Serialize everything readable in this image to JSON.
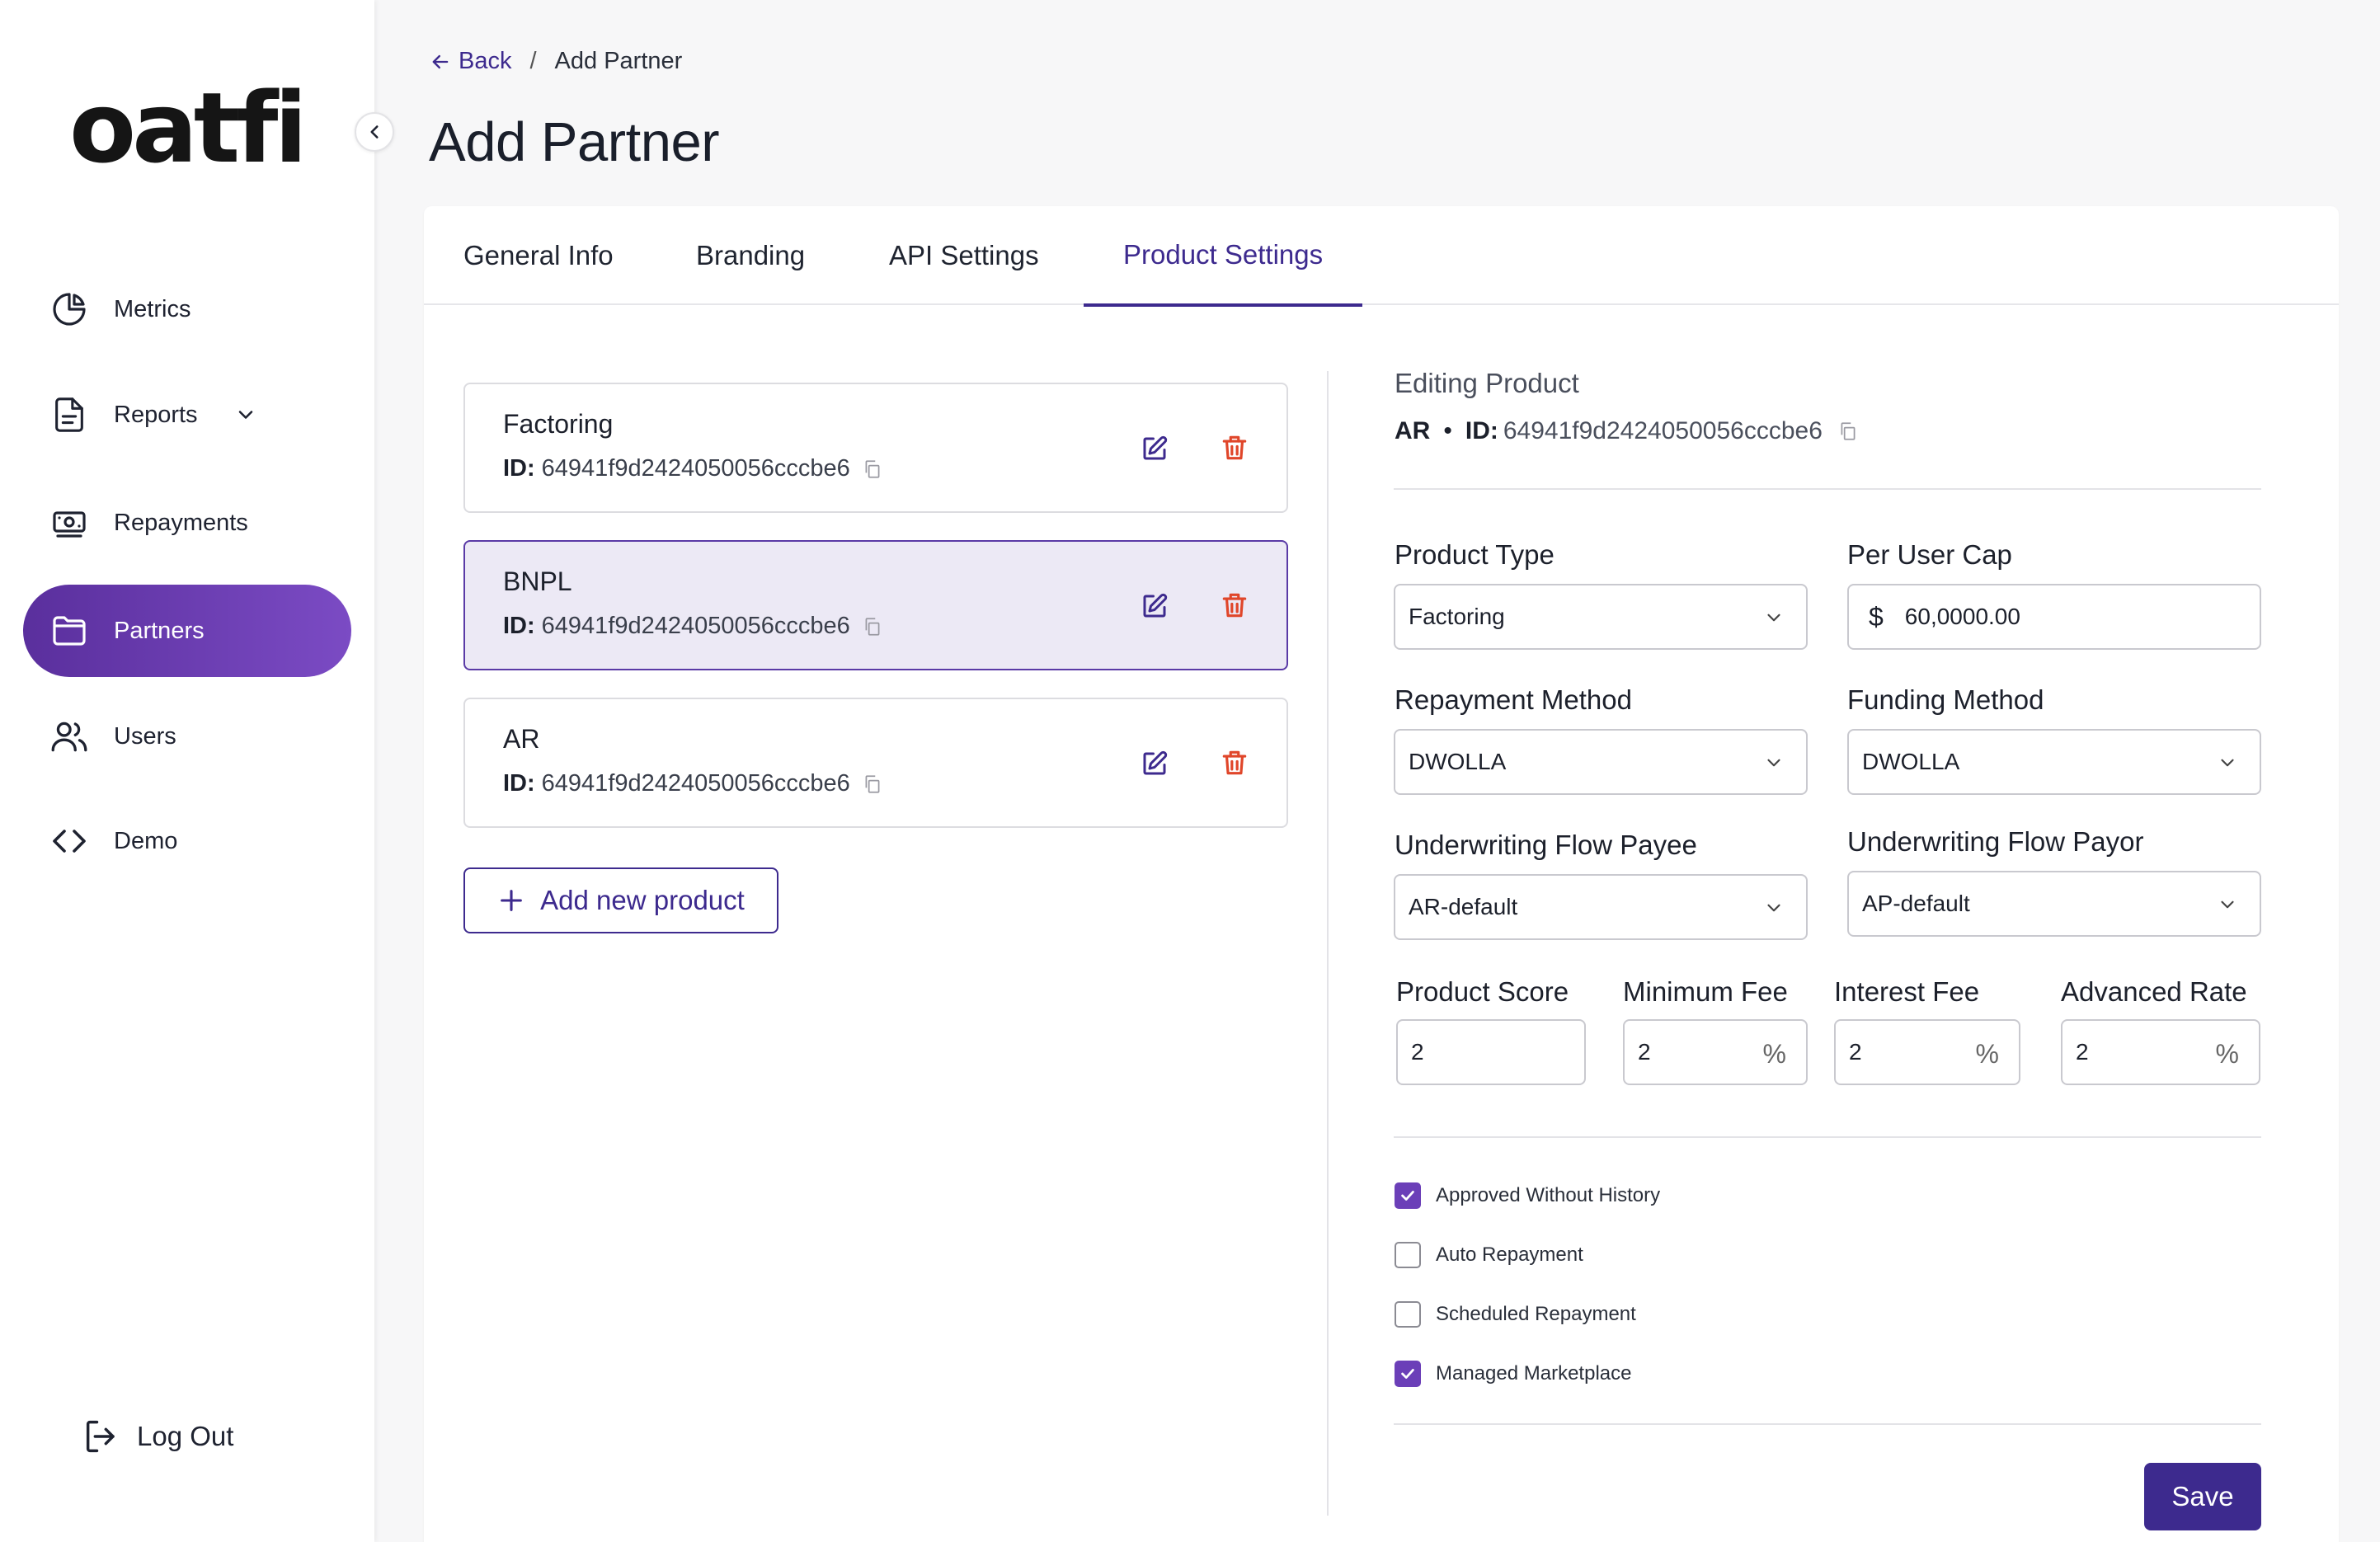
{
  "app": {
    "logo_text": "oatfi"
  },
  "sidebar": {
    "items": [
      {
        "label": "Metrics",
        "icon": "pie-chart-icon"
      },
      {
        "label": "Reports",
        "icon": "document-icon",
        "has_dropdown": true
      },
      {
        "label": "Repayments",
        "icon": "cash-icon"
      },
      {
        "label": "Partners",
        "icon": "folder-icon",
        "active": true
      },
      {
        "label": "Users",
        "icon": "users-icon"
      },
      {
        "label": "Demo",
        "icon": "code-icon"
      }
    ],
    "logout_label": "Log Out"
  },
  "breadcrumb": {
    "back_label": "Back",
    "separator": "/",
    "current": "Add Partner"
  },
  "page_title": "Add Partner",
  "tabs": [
    {
      "label": "General Info"
    },
    {
      "label": "Branding"
    },
    {
      "label": "API Settings"
    },
    {
      "label": "Product Settings",
      "active": true
    }
  ],
  "products": [
    {
      "name": "Factoring",
      "id_label": "ID:",
      "id": "64941f9d2424050056cccbe6"
    },
    {
      "name": "BNPL",
      "id_label": "ID:",
      "id": "64941f9d2424050056cccbe6",
      "selected": true
    },
    {
      "name": "AR",
      "id_label": "ID:",
      "id": "64941f9d2424050056cccbe6"
    }
  ],
  "add_product_label": "Add new product",
  "editing": {
    "heading": "Editing Product",
    "product_name": "AR",
    "bullet": "•",
    "id_label": "ID:",
    "id": "64941f9d2424050056cccbe6"
  },
  "form": {
    "product_type": {
      "label": "Product Type",
      "value": "Factoring"
    },
    "per_user_cap": {
      "label": "Per User Cap",
      "currency": "$",
      "value": "60,0000.00"
    },
    "repayment_method": {
      "label": "Repayment Method",
      "value": "DWOLLA"
    },
    "funding_method": {
      "label": "Funding Method",
      "value": "DWOLLA"
    },
    "uw_flow_payee": {
      "label": "Underwriting Flow Payee",
      "value": "AR-default"
    },
    "uw_flow_payor": {
      "label": "Underwriting Flow Payor",
      "value": "AP-default"
    },
    "product_score": {
      "label": "Product Score",
      "value": "2"
    },
    "minimum_fee": {
      "label": "Minimum Fee",
      "value": "2",
      "unit": "%"
    },
    "interest_fee": {
      "label": "Interest Fee",
      "value": "2",
      "unit": "%"
    },
    "advanced_rate": {
      "label": "Advanced Rate",
      "value": "2",
      "unit": "%"
    }
  },
  "checkboxes": [
    {
      "label": "Approved Without History",
      "checked": true
    },
    {
      "label": "Auto Repayment",
      "checked": false
    },
    {
      "label": "Scheduled Repayment",
      "checked": false
    },
    {
      "label": "Managed Marketplace",
      "checked": true
    }
  ],
  "save_label": "Save",
  "colors": {
    "primary": "#3d2a8e",
    "active_gradient_start": "#5a2f9d",
    "active_gradient_end": "#7b4bc4",
    "delete": "#e0462a",
    "selected_card_bg": "#ece9f5"
  }
}
